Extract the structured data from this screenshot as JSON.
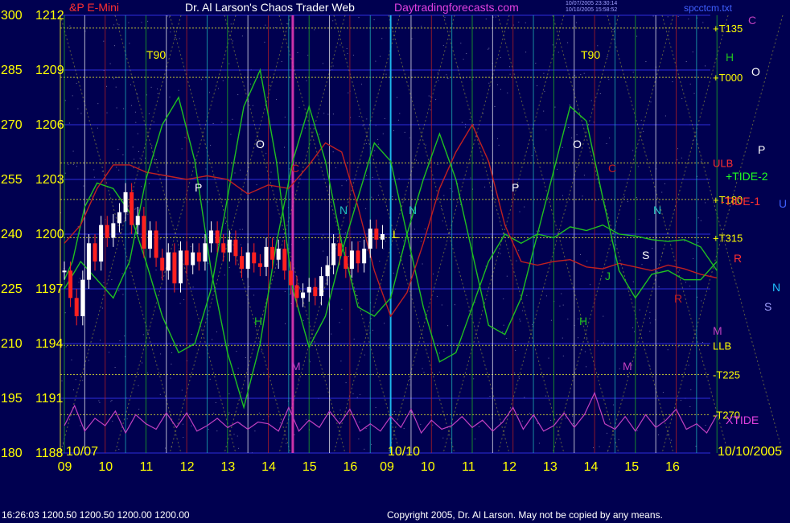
{
  "header": {
    "symbol": "&P E-Mini",
    "title": "Dr. Al Larson's Chaos Trader Web",
    "site": "Daytradingforecasts.com",
    "stamp_line1": "10/07/2005 23:30:14",
    "stamp_line2": "10/10/2005 15:58:52",
    "file": "spcctcm.txt"
  },
  "footer": {
    "quote": "16:26:03  1200.50 1200.50 1200.00 1200.00",
    "copyright": "Copyright 2005, Dr. Al Larson. May not be copied by any means."
  },
  "colors": {
    "background": "#000050",
    "price_up": "#ffffff",
    "price_down": "#ff2020",
    "tide": "#20c020",
    "red_line": "#c02020",
    "xtide": "#c040c0",
    "grid_yellow": "#d8d830",
    "axis_yellow": "#ffff00"
  },
  "chart_data": {
    "type": "line",
    "ylim": [
      1188,
      1212
    ],
    "y_ticks": [
      {
        "deg": "300",
        "price": "1212",
        "value": 1212
      },
      {
        "deg": "285",
        "price": "1209",
        "value": 1209
      },
      {
        "deg": "270",
        "price": "1206",
        "value": 1206
      },
      {
        "deg": "255",
        "price": "1203",
        "value": 1203
      },
      {
        "deg": "240",
        "price": "1200",
        "value": 1200
      },
      {
        "deg": "225",
        "price": "1197",
        "value": 1197
      },
      {
        "deg": "210",
        "price": "1194",
        "value": 1194
      },
      {
        "deg": "195",
        "price": "1191",
        "value": 1191
      },
      {
        "deg": "180",
        "price": "1188",
        "value": 1188
      }
    ],
    "x_ticks": [
      "09",
      "10",
      "11",
      "12",
      "13",
      "14",
      "15",
      "16",
      "09",
      "10",
      "11",
      "12",
      "13",
      "14",
      "15",
      "16"
    ],
    "date_labels": [
      "10/07",
      "10/10",
      "10/10/2005"
    ],
    "right_levels": [
      {
        "label": "T135",
        "value": 1211.3
      },
      {
        "label": "T000",
        "value": 1208.6
      },
      {
        "label": "ULB",
        "value": 1203.9
      },
      {
        "label": "T180",
        "value": 1201.9
      },
      {
        "label": "T315",
        "value": 1199.8
      },
      {
        "label": "LLB",
        "value": 1193.9
      },
      {
        "label": "T225",
        "value": 1192.3
      },
      {
        "label": "T270",
        "value": 1190.1
      }
    ],
    "series": [
      {
        "name": "TIDE-2",
        "x": [
          0,
          0.2,
          0.5,
          0.8,
          1.2,
          1.6,
          2,
          2.4,
          2.8,
          3.2,
          3.6,
          4,
          4.4,
          4.8,
          5.2,
          5.6,
          6,
          6.4,
          6.8,
          7.2,
          7.6,
          8,
          8.4,
          8.8,
          9.2,
          9.6,
          10,
          10.4,
          10.8,
          11.2,
          11.6,
          12,
          12.4,
          12.8,
          13.2,
          13.6,
          14,
          14.4,
          14.8,
          15.2,
          15.6,
          16
        ],
        "y": [
          1197.5,
          1198.5,
          1201.5,
          1202.8,
          1202.5,
          1201.2,
          1198.5,
          1195.5,
          1193.5,
          1194,
          1197,
          1202,
          1207,
          1209,
          1204,
          1197,
          1193.8,
          1195.5,
          1199,
          1202,
          1205,
          1204,
          1200,
          1196,
          1193,
          1193.5,
          1196,
          1198.5,
          1200,
          1199.5,
          1200,
          1199.8,
          1200.4,
          1200.2,
          1200.5,
          1200,
          1199.9,
          1199.7,
          1199.6,
          1199.7,
          1199.3,
          1198
        ]
      },
      {
        "name": "TIDE-1",
        "x": [
          0,
          0.4,
          0.8,
          1.2,
          1.6,
          2,
          2.5,
          3,
          3.5,
          4,
          4.5,
          5,
          5.5,
          6,
          6.4,
          6.8,
          7.2,
          7.6,
          8,
          8.4,
          8.8,
          9.2,
          9.6,
          10,
          10.4,
          10.8,
          11.2,
          11.6,
          12,
          12.4,
          12.8,
          13.2,
          13.6,
          14,
          14.4,
          14.8,
          15.2,
          15.6,
          16
        ],
        "y": [
          1199.5,
          1200.5,
          1202.5,
          1203.8,
          1203.8,
          1203.4,
          1203.2,
          1203,
          1203.2,
          1203,
          1202.2,
          1202.7,
          1202.5,
          1203.8,
          1205,
          1204.5,
          1201.5,
          1198,
          1195.5,
          1196.8,
          1199.5,
          1202.5,
          1204.5,
          1206,
          1204,
          1200.5,
          1198.5,
          1198.3,
          1198.5,
          1198.6,
          1198.2,
          1198.1,
          1198.4,
          1198.2,
          1198,
          1198.3,
          1198.1,
          1197.8,
          1197.6
        ]
      },
      {
        "name": "Forecast",
        "x": [
          0,
          0.4,
          0.8,
          1.2,
          1.6,
          2,
          2.4,
          2.8,
          3.2,
          3.6,
          4,
          4.4,
          4.8,
          5.2,
          5.6,
          6,
          6.4,
          6.8,
          7.2,
          7.6,
          8,
          8.4,
          8.8,
          9.2,
          9.6,
          10,
          10.4,
          10.8,
          11.2,
          11.6,
          12,
          12.4,
          12.8,
          13.2,
          13.6,
          14,
          14.4,
          14.8,
          15.2,
          15.6,
          16
        ],
        "y": [
          1197,
          1198.5,
          1197.5,
          1196.5,
          1198.5,
          1203,
          1206,
          1207.5,
          1204,
          1198,
          1193.5,
          1190.5,
          1194,
          1199.5,
          1204,
          1207,
          1204,
          1199.5,
          1196,
          1195.5,
          1196.5,
          1200,
          1203,
          1205.5,
          1203,
          1199,
          1195,
          1194.5,
          1196.5,
          1200,
          1203.5,
          1207,
          1206.2,
          1202,
          1198,
          1196.5,
          1197.8,
          1198,
          1197.5,
          1197.5,
          1198.5
        ]
      },
      {
        "name": "Price",
        "x": [
          0,
          0.15,
          0.3,
          0.45,
          0.6,
          0.75,
          0.9,
          1.05,
          1.2,
          1.35,
          1.5,
          1.65,
          1.8,
          1.95,
          2.1,
          2.25,
          2.4,
          2.55,
          2.7,
          2.85,
          3,
          3.15,
          3.3,
          3.45,
          3.6,
          3.75,
          3.9,
          4.05,
          4.2,
          4.35,
          4.5,
          4.65,
          4.8,
          4.95,
          5.1,
          5.25,
          5.4,
          5.55,
          5.7,
          5.85,
          6,
          6.15,
          6.3,
          6.45,
          6.6,
          6.75,
          6.9,
          7.05,
          7.2,
          7.35,
          7.5,
          7.65,
          7.8
        ],
        "y": [
          1198,
          1196.5,
          1195.5,
          1197.5,
          1199.5,
          1198.5,
          1200.5,
          1199.8,
          1200.6,
          1201.2,
          1202.3,
          1200.5,
          1201,
          1199.2,
          1200.2,
          1198.7,
          1198,
          1199,
          1197.3,
          1199.1,
          1198.3,
          1199,
          1198.5,
          1199.5,
          1200.2,
          1199.5,
          1199,
          1199.7,
          1198.8,
          1198.1,
          1199,
          1198.4,
          1198.2,
          1199.3,
          1198.6,
          1199.2,
          1198,
          1197.2,
          1196.5,
          1196.8,
          1197.1,
          1196.6,
          1197.7,
          1198.3,
          1199.5,
          1198.8,
          1198.1,
          1199.1,
          1198.4,
          1199.2,
          1200.3,
          1199.7,
          1200
        ]
      },
      {
        "name": "XTIDE",
        "x": [
          0,
          0.25,
          0.5,
          0.75,
          1,
          1.25,
          1.5,
          1.75,
          2,
          2.25,
          2.5,
          2.75,
          3,
          3.25,
          3.5,
          3.75,
          4,
          4.25,
          4.5,
          4.75,
          5,
          5.25,
          5.5,
          5.75,
          6,
          6.25,
          6.5,
          6.75,
          7,
          7.25,
          7.5,
          7.75,
          8,
          8.25,
          8.5,
          8.75,
          9,
          9.25,
          9.5,
          9.75,
          10,
          10.25,
          10.5,
          10.75,
          11,
          11.25,
          11.5,
          11.75,
          12,
          12.25,
          12.5,
          12.75,
          13,
          13.25,
          13.5,
          13.75,
          14,
          14.25,
          14.5,
          14.75,
          15,
          15.25,
          15.5,
          15.75,
          16
        ],
        "y": [
          1189.5,
          1190.6,
          1189.2,
          1189.9,
          1189.5,
          1190.3,
          1189.1,
          1190.1,
          1189.6,
          1189.3,
          1190.2,
          1189.4,
          1190.2,
          1189.2,
          1189.5,
          1189.9,
          1189.4,
          1189.7,
          1189.3,
          1189.7,
          1189.6,
          1189.2,
          1190.5,
          1189.2,
          1189.8,
          1189.4,
          1190.3,
          1189.6,
          1190.4,
          1189.2,
          1189.6,
          1189.2,
          1190,
          1189.4,
          1190.4,
          1189.1,
          1189.8,
          1189.3,
          1189.5,
          1190,
          1189.4,
          1189.8,
          1189.2,
          1189.7,
          1190.5,
          1189.3,
          1190.1,
          1189.2,
          1189.5,
          1190.2,
          1189.4,
          1190.1,
          1191.3,
          1189.6,
          1189.3,
          1190,
          1189.2,
          1190.1,
          1189.4,
          1189.8,
          1190.4,
          1189.3,
          1189.6,
          1189.1,
          1190.1
        ]
      }
    ],
    "annotations": [
      "T90",
      "T90",
      "O",
      "O",
      "O",
      "P",
      "P",
      "P",
      "N",
      "N",
      "N",
      "N",
      "H",
      "H",
      "H",
      "M",
      "M",
      "M",
      "C",
      "C",
      "C",
      "S",
      "S",
      "R",
      "R",
      "J",
      "L",
      "+TIDE-2",
      "-TIDE-1",
      "XTIDE",
      "U"
    ]
  }
}
